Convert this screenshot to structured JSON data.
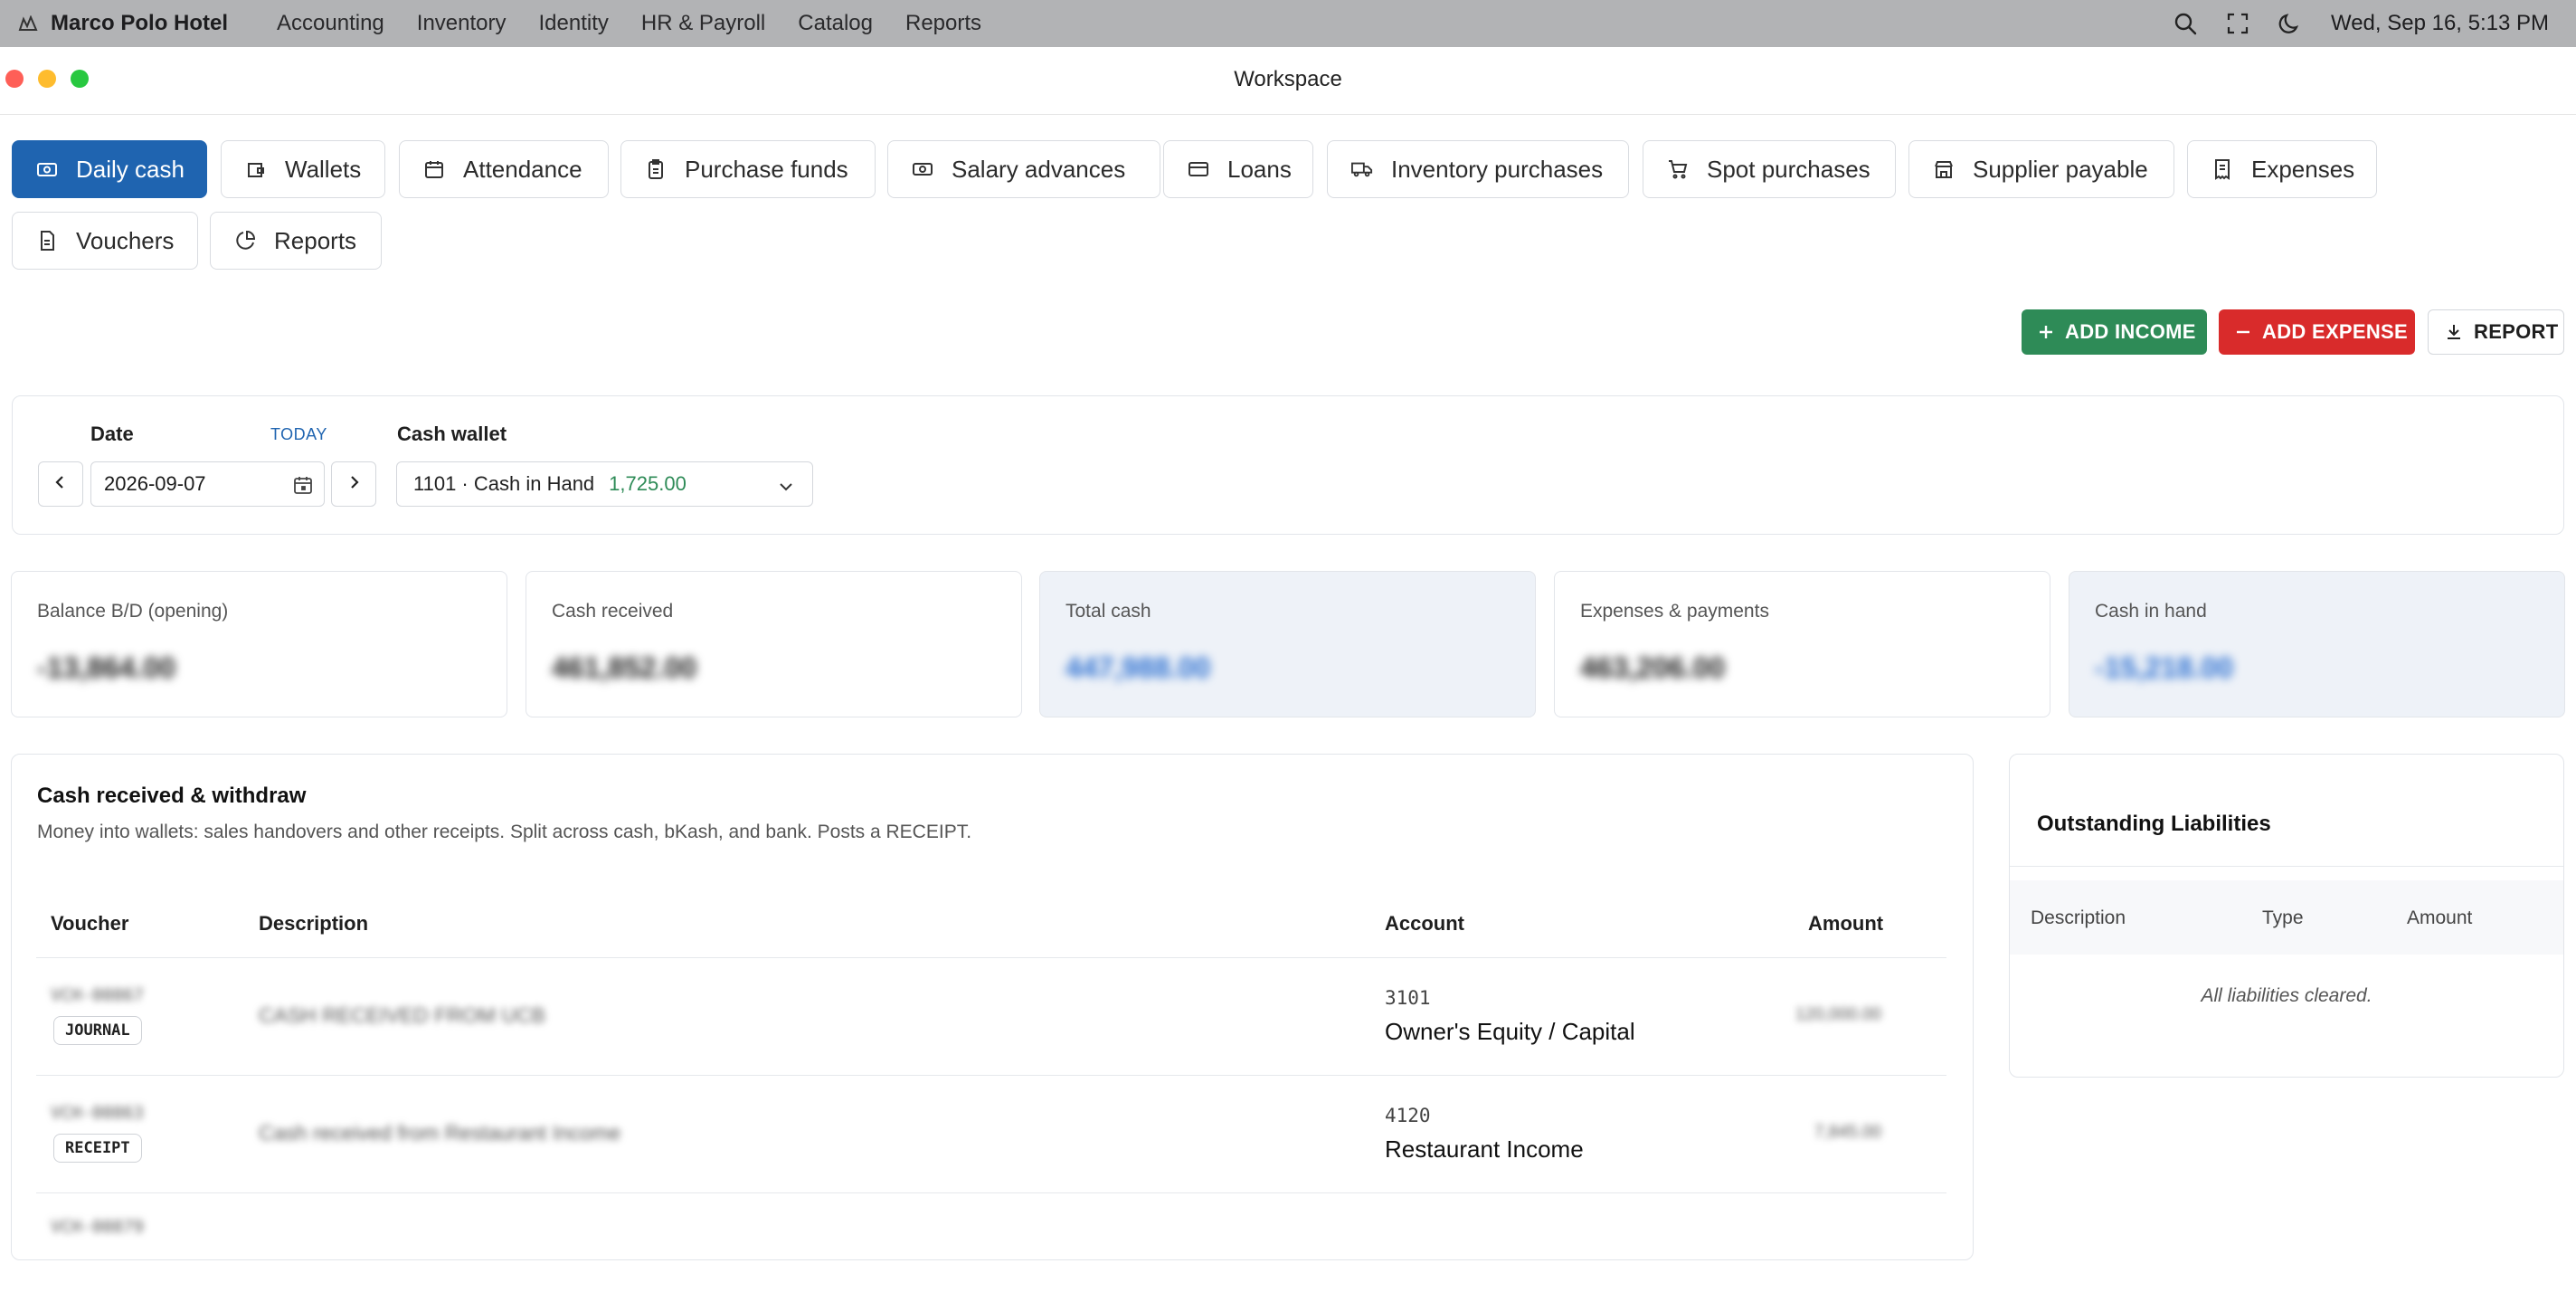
{
  "menubar": {
    "app_name": "Marco Polo Hotel",
    "menus": [
      "Accounting",
      "Inventory",
      "Identity",
      "HR & Payroll",
      "Catalog",
      "Reports"
    ],
    "clock": "Wed, Sep 16, 5:13 PM"
  },
  "window": {
    "title": "Workspace"
  },
  "tabs": [
    {
      "label": "Daily cash",
      "icon": "cash-icon",
      "active": true
    },
    {
      "label": "Wallets",
      "icon": "wallet-icon"
    },
    {
      "label": "Attendance",
      "icon": "calendar-icon"
    },
    {
      "label": "Purchase funds",
      "icon": "clipboard-icon"
    },
    {
      "label": "Salary advances",
      "icon": "banknote-icon"
    },
    {
      "label": "Loans",
      "icon": "credit-card-icon"
    },
    {
      "label": "Inventory purchases",
      "icon": "truck-icon"
    },
    {
      "label": "Spot purchases",
      "icon": "cart-icon"
    },
    {
      "label": "Supplier payable",
      "icon": "store-icon"
    },
    {
      "label": "Expenses",
      "icon": "receipt-icon"
    },
    {
      "label": "Vouchers",
      "icon": "document-icon"
    },
    {
      "label": "Reports",
      "icon": "pie-chart-icon"
    }
  ],
  "actions": {
    "add_income": "ADD INCOME",
    "add_expense": "ADD EXPENSE",
    "report": "REPORT",
    "colors": {
      "income": "#2e8b57",
      "expense": "#d92b2b"
    }
  },
  "filters": {
    "date_label": "Date",
    "today_link": "TODAY",
    "date_value": "2026-09-07",
    "wallet_label": "Cash wallet",
    "wallet_name": "1101 · Cash in Hand",
    "wallet_balance": "1,725.00"
  },
  "stats": [
    {
      "title": "Balance B/D (opening)",
      "value": "-13,864.00",
      "highlight": false
    },
    {
      "title": "Cash received",
      "value": "461,852.00",
      "highlight": false
    },
    {
      "title": "Total cash",
      "value": "447,988.00",
      "highlight": true
    },
    {
      "title": "Expenses & payments",
      "value": "463,206.00",
      "highlight": false
    },
    {
      "title": "Cash in hand",
      "value": "-15,218.00",
      "highlight": true
    }
  ],
  "receipts": {
    "title": "Cash received & withdraw",
    "subtitle": "Money into wallets: sales handovers and other receipts. Split across cash, bKash, and bank. Posts a RECEIPT.",
    "columns": {
      "voucher": "Voucher",
      "description": "Description",
      "account": "Account",
      "amount": "Amount"
    },
    "rows": [
      {
        "voucher_no": "VCH-00867",
        "type": "JOURNAL",
        "description": "CASH RECEIVED FROM UCB",
        "account_code": "3101",
        "account_name": "Owner's Equity / Capital",
        "amount": "120,000.00"
      },
      {
        "voucher_no": "VCH-00863",
        "type": "RECEIPT",
        "description": "Cash received from Restaurant Income",
        "account_code": "4120",
        "account_name": "Restaurant Income",
        "amount": "7,845.00"
      },
      {
        "voucher_no": "VCH-00879"
      }
    ]
  },
  "liabilities": {
    "title": "Outstanding Liabilities",
    "columns": {
      "description": "Description",
      "type": "Type",
      "amount": "Amount"
    },
    "empty_text": "All liabilities cleared."
  }
}
